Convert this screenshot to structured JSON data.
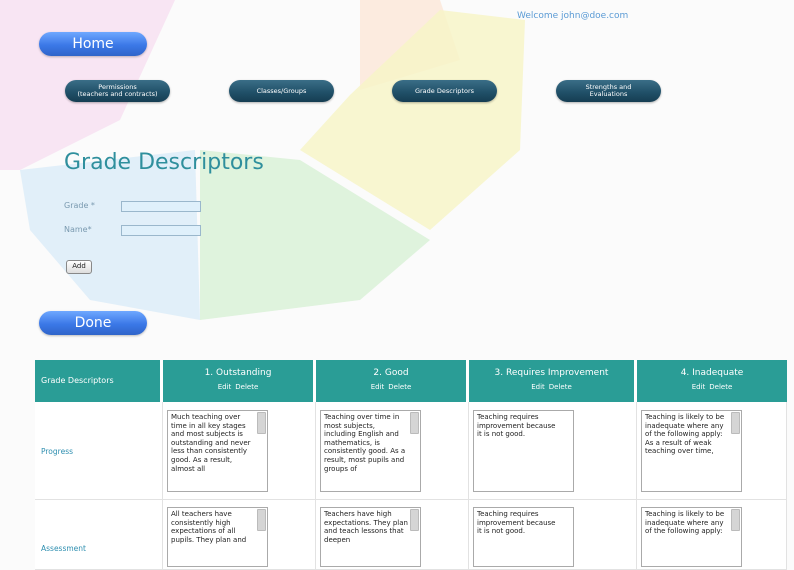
{
  "header": {
    "welcome": "Welcome john@doe.com",
    "home_label": "Home"
  },
  "nav": {
    "permissions_label": "Permissions\n(teachers and contracts)",
    "classes_label": "Classes/Groups",
    "grade_descriptors_label": "Grade Descriptors",
    "strengths_label": "Strengths and\nEvaluations"
  },
  "page": {
    "title": "Grade Descriptors"
  },
  "form": {
    "grade_label": "Grade *",
    "grade_value": "",
    "name_label": "Name*",
    "name_value": "",
    "add_label": "Add"
  },
  "done_label": "Done",
  "table": {
    "corner": "Grade Descriptors",
    "edit_label": "Edit",
    "delete_label": "Delete",
    "columns": [
      "1. Outstanding",
      "2. Good",
      "3. Requires Improvement",
      "4. Inadequate"
    ],
    "rows": [
      {
        "label": "Progress",
        "cells": [
          "Much teaching over time in all key stages and most subjects is outstanding and never less than consistently good. As a result, almost all",
          "Teaching over time in most subjects, including English and mathematics, is consistently good. As a result, most pupils and groups of",
          "Teaching requires improvement because it is not good.",
          "Teaching is likely to be inadequate where any of the following apply: As a result of weak teaching over time,"
        ]
      },
      {
        "label": "Assessment",
        "cells": [
          "All teachers have consistently high expectations of all pupils. They plan and",
          "Teachers have high expectations. They plan and teach lessons that deepen",
          "Teaching requires improvement because it is not good.",
          "Teaching is likely to be inadequate where any of the following apply:"
        ]
      }
    ]
  }
}
